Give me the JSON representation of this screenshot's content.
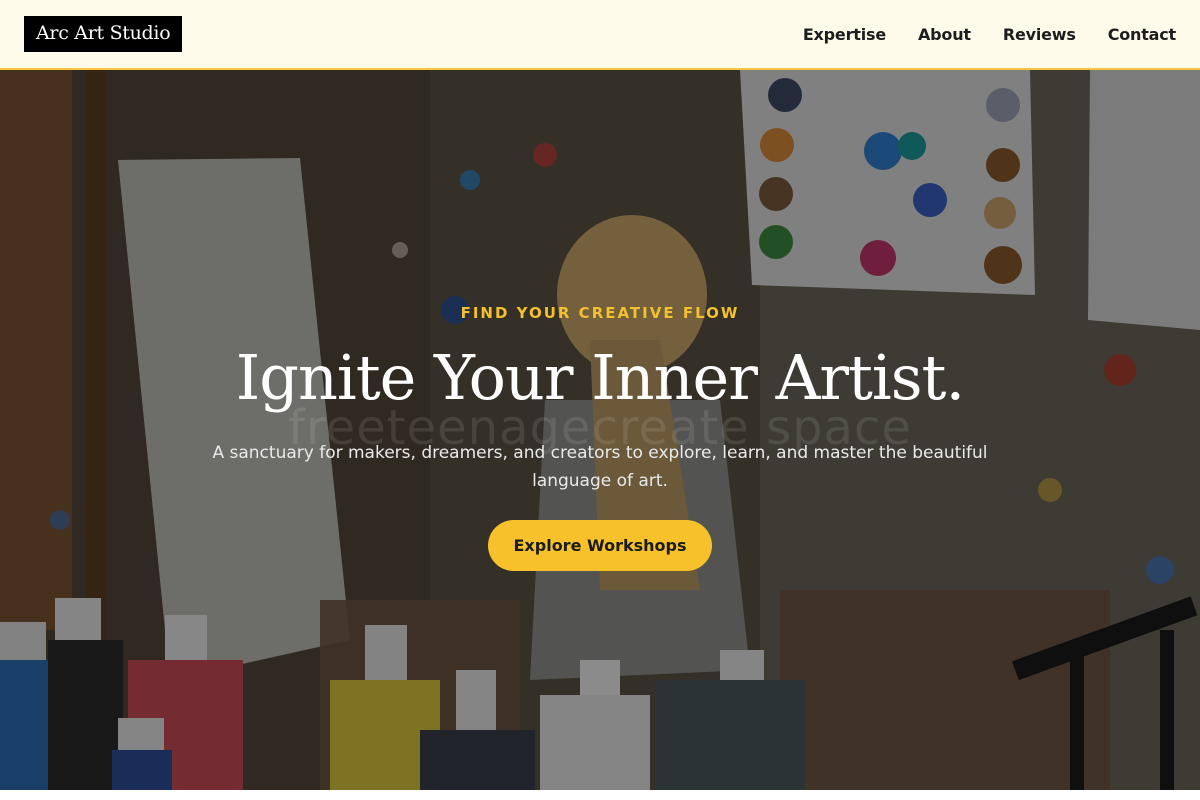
{
  "nav": {
    "logo": "Arc Art Studio",
    "links": [
      "Expertise",
      "About",
      "Reviews",
      "Contact"
    ]
  },
  "hero": {
    "eyebrow": "FIND YOUR CREATIVE FLOW",
    "headline": "Ignite Your Inner Artist.",
    "subtext": "A sanctuary for makers, dreamers, and creators to explore, learn, and master the beautiful language of art.",
    "cta_label": "Explore Workshops",
    "background_text": "freeteenagecreate space"
  },
  "colors": {
    "accent": "#f6c12b",
    "nav_background": "#fffbea",
    "logo_background": "#000000"
  }
}
